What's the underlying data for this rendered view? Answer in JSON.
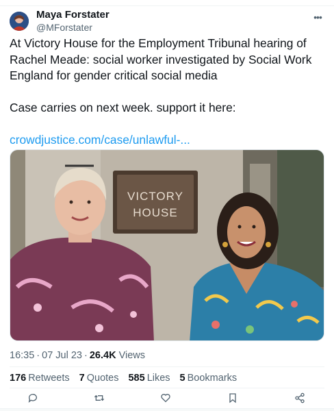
{
  "author": {
    "display_name": "Maya Forstater",
    "handle": "@MForstater"
  },
  "tweet": {
    "line1": "At Victory House for the Employment Tribunal hearing of Rachel Meade: social worker investigated by Social Work England for gender critical social media",
    "line2": "Case carries on next week. support it here:",
    "link": "crowdjustice.com/case/unlawful-..."
  },
  "photo": {
    "sign_line1": "VICTORY",
    "sign_line2": "HOUSE"
  },
  "meta": {
    "time": "16:35",
    "date": "07 Jul 23",
    "views_count": "26.4K",
    "views_label": "Views"
  },
  "stats": [
    {
      "count": "176",
      "label": "Retweets"
    },
    {
      "count": "7",
      "label": "Quotes"
    },
    {
      "count": "585",
      "label": "Likes"
    },
    {
      "count": "5",
      "label": "Bookmarks"
    }
  ],
  "icons": {
    "reply": "reply-icon",
    "retweet": "retweet-icon",
    "like": "heart-icon",
    "bookmark": "bookmark-icon",
    "share": "share-icon",
    "more": "more-icon"
  },
  "colors": {
    "link": "#1d9bf0",
    "text": "#0f1419",
    "secondary": "#536471"
  }
}
